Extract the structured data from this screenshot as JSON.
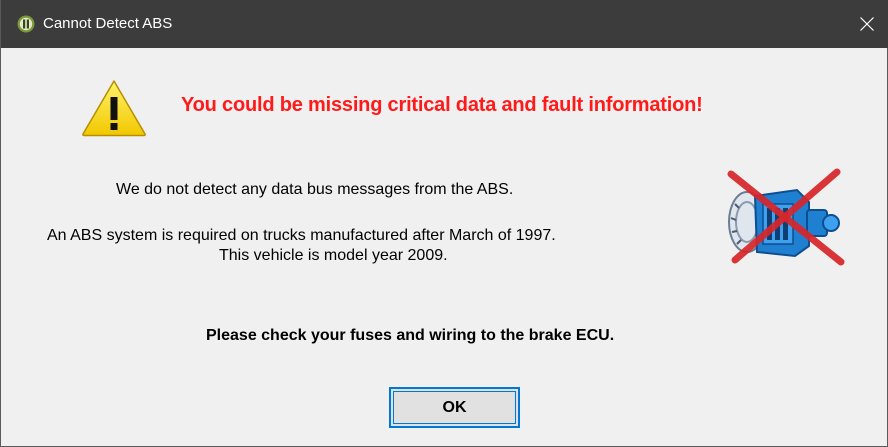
{
  "window": {
    "title": "Cannot Detect ABS",
    "app_icon": "app-logo-icon",
    "close_icon": "close-icon"
  },
  "alert": {
    "icon": "warning-icon",
    "headline": "You could be missing critical data and fault information!",
    "headline_color": "#ff1a1a"
  },
  "body": {
    "line1": "We do not detect any data bus messages from the ABS.",
    "line2": "An ABS system is required on trucks manufactured after March of 1997.",
    "line3": "This vehicle is model year 2009.",
    "image_icon": "abs-brake-crossed-out-icon",
    "check_line": "Please check your fuses and wiring to the brake ECU."
  },
  "buttons": {
    "ok_label": "OK"
  },
  "colors": {
    "titlebar": "#3c3c3c",
    "background": "#f0f0f0",
    "focus": "#0078d7"
  }
}
